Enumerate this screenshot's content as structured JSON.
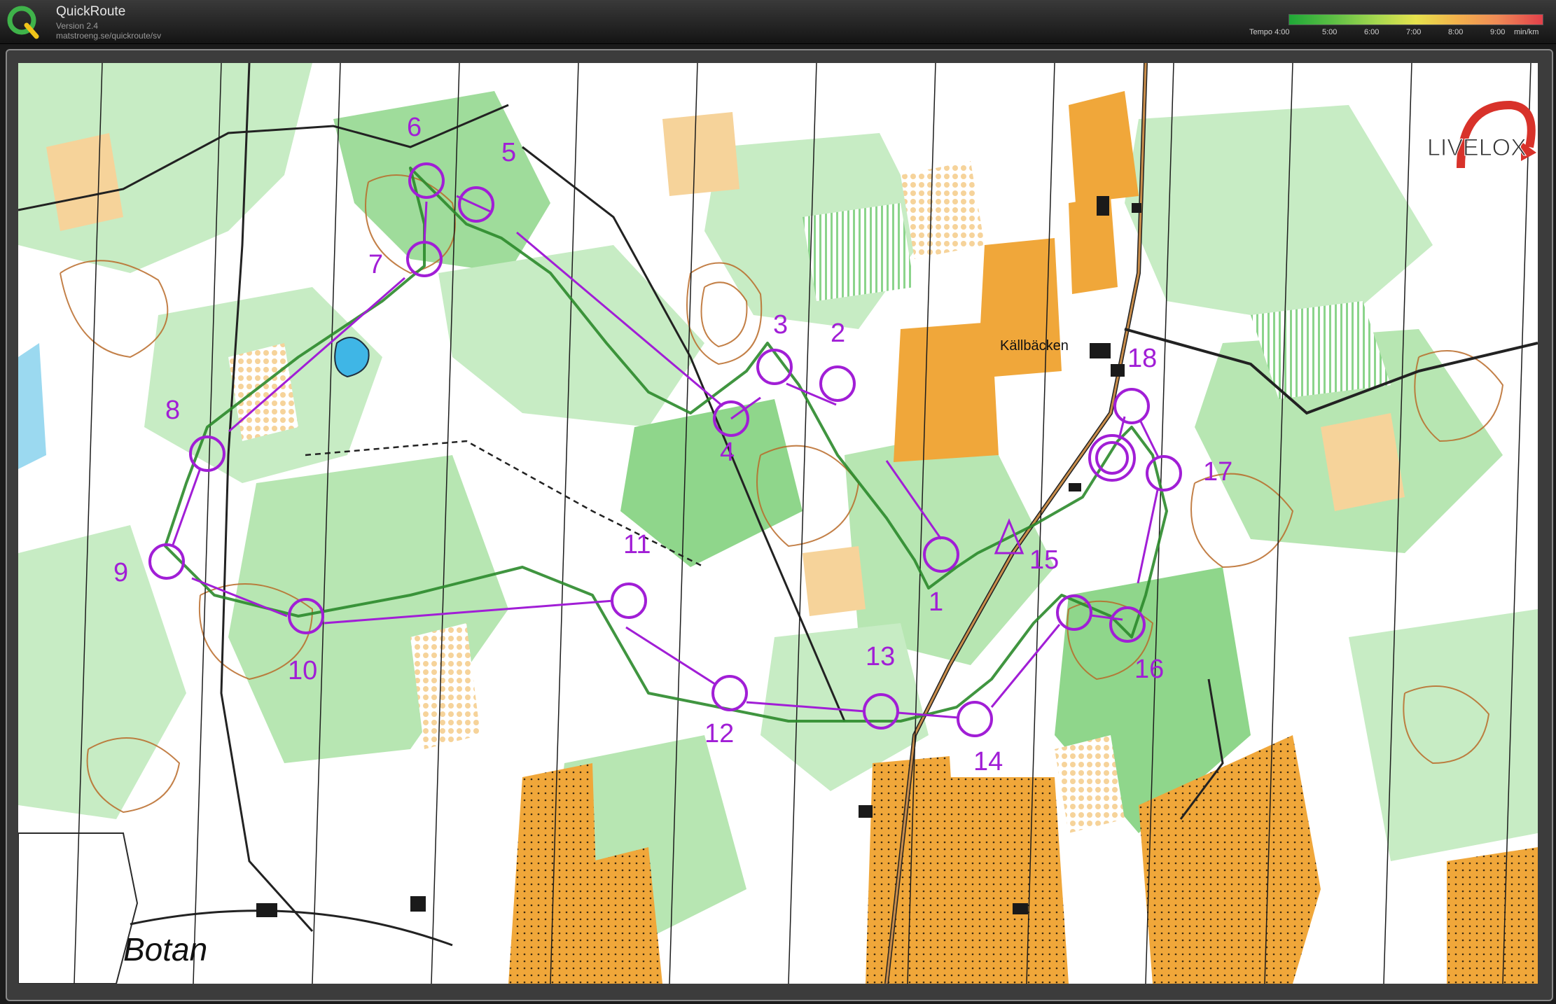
{
  "app": {
    "title": "QuickRoute",
    "version": "Version 2.4",
    "url": "matstroeng.se/quickroute/sv"
  },
  "tempo_legend": {
    "label": "Tempo 4:00",
    "ticks": [
      "5:00",
      "6:00",
      "7:00",
      "8:00",
      "9:00"
    ],
    "unit": "min/km",
    "colors": [
      "#1fa837",
      "#a8d84f",
      "#e6e24d",
      "#f2b24c",
      "#e2404a"
    ]
  },
  "map": {
    "brand": "LIVELOX",
    "place_labels": {
      "village": "Källbäcken",
      "lake": "Botan"
    },
    "course_color": "#a11ed6",
    "controls": [
      {
        "num": "1"
      },
      {
        "num": "2"
      },
      {
        "num": "3"
      },
      {
        "num": "4"
      },
      {
        "num": "5"
      },
      {
        "num": "6"
      },
      {
        "num": "7"
      },
      {
        "num": "8"
      },
      {
        "num": "9"
      },
      {
        "num": "10"
      },
      {
        "num": "11"
      },
      {
        "num": "12"
      },
      {
        "num": "13"
      },
      {
        "num": "14"
      },
      {
        "num": "15"
      },
      {
        "num": "16"
      },
      {
        "num": "17"
      },
      {
        "num": "18"
      }
    ]
  }
}
